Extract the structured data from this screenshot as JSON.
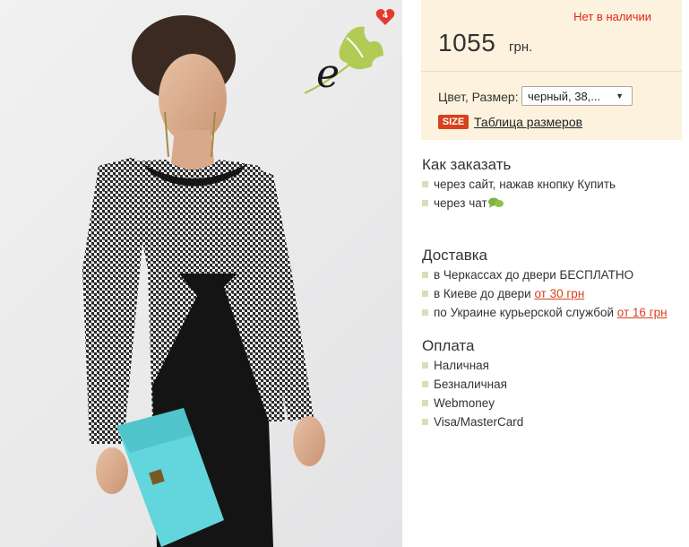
{
  "product": {
    "favorites_count": "4",
    "logo_letter": "e"
  },
  "price_panel": {
    "stock_status": "Нет в наличии",
    "price": "1055",
    "currency": "грн.",
    "options_label": "Цвет, Размер:",
    "options_selected": "черный, 38,...",
    "size_badge": "SIZE",
    "size_table_link": "Таблица размеров"
  },
  "how_to_order": {
    "title": "Как заказать",
    "items": [
      "через сайт, нажав кнопку Купить",
      "через чат"
    ]
  },
  "delivery": {
    "title": "Доставка",
    "items": [
      {
        "text": "в Черкассах до двери БЕСПЛАТНО",
        "link": ""
      },
      {
        "text": "в Киеве до двери ",
        "link": "от 30 грн"
      },
      {
        "text": "по Украине курьерской службой ",
        "link": "от 16 грн"
      }
    ]
  },
  "payment": {
    "title": "Оплата",
    "items": [
      "Наличная",
      "Безналичная",
      "Webmoney",
      "Visa/MasterCard"
    ]
  },
  "colors": {
    "accent": "#d8411c",
    "stock_red": "#e0241b",
    "panel_bg": "#fcf2dd",
    "bullet": "#d7dfb9",
    "chat_green": "#7cb342"
  }
}
